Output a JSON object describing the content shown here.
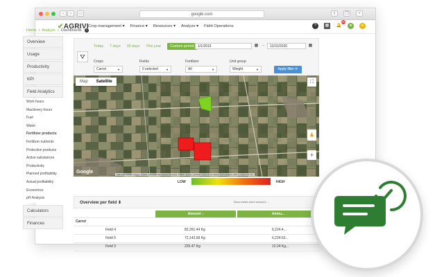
{
  "browser": {
    "url": "google.com"
  },
  "topnav": {
    "logo": "AGRIVI",
    "menu": [
      "Crop management ▾",
      "Finance ▾",
      "Resources ▾",
      "Analyze ▾",
      "Field Operations"
    ],
    "notification_count": "99"
  },
  "breadcrumb": {
    "items": [
      "Home",
      "Analyze",
      "Dashboards"
    ]
  },
  "sidebar": {
    "sections": [
      "Overview",
      "Usage",
      "Productivity",
      "KPI",
      "Field Analytics"
    ],
    "sub_items": [
      "Work hours",
      "Machinery hours",
      "Fuel",
      "Water",
      "Fertilizer products",
      "Fertilizer nutrients",
      "Protection products",
      "Active substances",
      "Productivity",
      "Planned profitability",
      "Actual profitability",
      "Economics",
      "pH Analysis"
    ],
    "active_sub": "Fertilizer products",
    "bottom_sections": [
      "Calculators",
      "Finances"
    ]
  },
  "filters": {
    "periods": [
      "Today",
      "7 days",
      "30 days",
      "This year",
      "Custom period"
    ],
    "date_from": "1/1/2019",
    "date_to": "12/31/2020",
    "crops_label": "Crops",
    "crops_value": "Carrot",
    "fields_label": "Fields",
    "fields_value": "0 selected",
    "fertilizer_label": "Fertilizer",
    "fertilizer_value": "All",
    "unit_label": "Unit group",
    "unit_value": "Weight",
    "apply_label": "Apply filter ⟳"
  },
  "map": {
    "tabs": [
      "Map",
      "Satellite"
    ],
    "active_tab": "Satellite",
    "google": "Google",
    "attribution": "Map data ©2020 Imagery ©2020 , Aerodata International Surveys, CNES / Airbus, Landsat / Copernicus, Maxar Technologies | 200 m | Terms of Use",
    "zoom_in": "+"
  },
  "legend": {
    "low": "LOW",
    "high": "HIGH"
  },
  "overview": {
    "title": "Overview per field ⬇",
    "note": "Show entries where amount is ..."
  },
  "table": {
    "header_amount": "Amount ↕",
    "header_amount2": "Amou...",
    "group": "Carrot",
    "rows": [
      {
        "field": "Field 4",
        "amount": "82,291.44 Kg",
        "amount2": "6,224.4..."
      },
      {
        "field": "Field 5",
        "amount": "72,143.68 Kg",
        "amount2": "6,224.63..."
      },
      {
        "field": "Field 3",
        "amount": "225.47 Kg",
        "amount2": "12.24 Kg..."
      }
    ]
  },
  "colors": {
    "brand_green": "#7cb342",
    "apply_blue": "#4a90d9",
    "chat_green": "#2e7d32"
  }
}
